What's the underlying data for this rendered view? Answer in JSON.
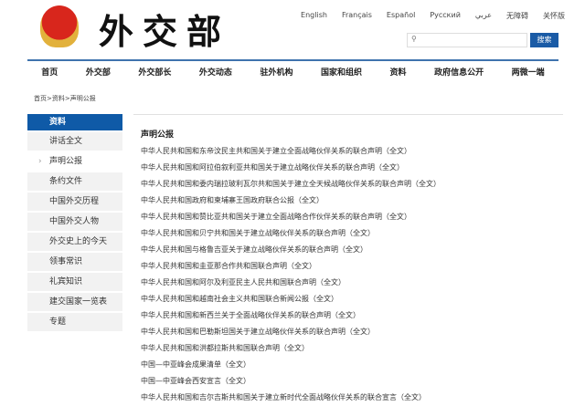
{
  "header": {
    "logo_text": "外交部",
    "languages": [
      "English",
      "Français",
      "Español",
      "Русский",
      "عربي",
      "无障碍",
      "关怀版"
    ],
    "search_placeholder": "⚲",
    "search_button": "搜索"
  },
  "nav": [
    "首页",
    "外交部",
    "外交部长",
    "外交动态",
    "驻外机构",
    "国家和组织",
    "资料",
    "政府信息公开",
    "两微一端"
  ],
  "breadcrumb": "首页>资料>声明公报",
  "sidebar": {
    "header": "资料",
    "items": [
      "讲话全文",
      "声明公报",
      "条约文件",
      "中国外交历程",
      "中国外交人物",
      "外交史上的今天",
      "领事常识",
      "礼宾知识",
      "建交国家一览表",
      "专题"
    ],
    "selected": 1
  },
  "content": {
    "title": "声明公报",
    "rows": [
      "中华人民共和国和东帝汶民主共和国关于建立全面战略伙伴关系的联合声明（全文）",
      "中华人民共和国和阿拉伯叙利亚共和国关于建立战略伙伴关系的联合声明（全文）",
      "中华人民共和国和委内瑞拉玻利瓦尔共和国关于建立全天候战略伙伴关系的联合声明（全文）",
      "中华人民共和国政府和柬埔寨王国政府联合公报（全文）",
      "中华人民共和国和赞比亚共和国关于建立全面战略合作伙伴关系的联合声明（全文）",
      "中华人民共和国和贝宁共和国关于建立战略伙伴关系的联合声明（全文）",
      "中华人民共和国与格鲁吉亚关于建立战略伙伴关系的联合声明（全文）",
      "中华人民共和国和圭亚那合作共和国联合声明（全文）",
      "中华人民共和国和阿尔及利亚民主人民共和国联合声明（全文）",
      "中华人民共和国和越南社会主义共和国联合新闻公报（全文）",
      "中华人民共和国和新西兰关于全面战略伙伴关系的联合声明（全文）",
      "中华人民共和国和巴勒斯坦国关于建立战略伙伴关系的联合声明（全文）",
      "中华人民共和国和洪都拉斯共和国联合声明（全文）",
      "中国—中亚峰会成果清单（全文）",
      "中国—中亚峰会西安宣言（全文）",
      "中华人民共和国和吉尔吉斯共和国关于建立新时代全面战略伙伴关系的联合宣言（全文）"
    ]
  }
}
